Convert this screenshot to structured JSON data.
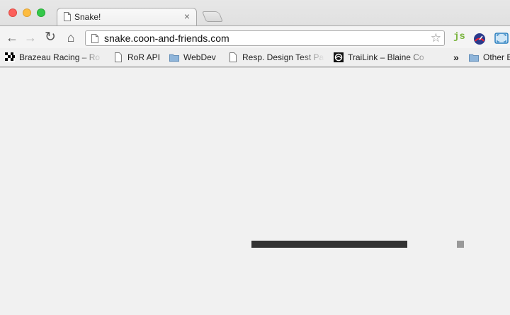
{
  "tab": {
    "title": "Snake!",
    "close": "×"
  },
  "toolbar": {
    "back": "←",
    "forward": "→",
    "reload": "↻",
    "home": "⌂",
    "url": "snake.coon-and-friends.com",
    "star": "☆",
    "extension_js": "js"
  },
  "bookmarks": [
    {
      "label": "Brazeau Racing – Ro",
      "icon": "checkered-flag-icon"
    },
    {
      "label": "RoR API",
      "icon": "page-icon"
    },
    {
      "label": "WebDev",
      "icon": "folder-icon"
    },
    {
      "label": "Resp. Design Test Pa",
      "icon": "page-icon"
    },
    {
      "label": "TraiLink – Blaine Co",
      "icon": "trailink-icon"
    },
    {
      "label": "Other B",
      "icon": "folder-icon"
    }
  ],
  "bookmarks_overflow": "»",
  "game": {
    "background": "#f1f1f1",
    "snake_color": "#333333",
    "food_color": "#999999",
    "grid_cells": {
      "cols": 72,
      "rows": 35
    },
    "snake_cells": {
      "row": 24,
      "col_start": 35,
      "col_end": 57
    },
    "food_cell": {
      "row": 24,
      "col": 64
    }
  }
}
